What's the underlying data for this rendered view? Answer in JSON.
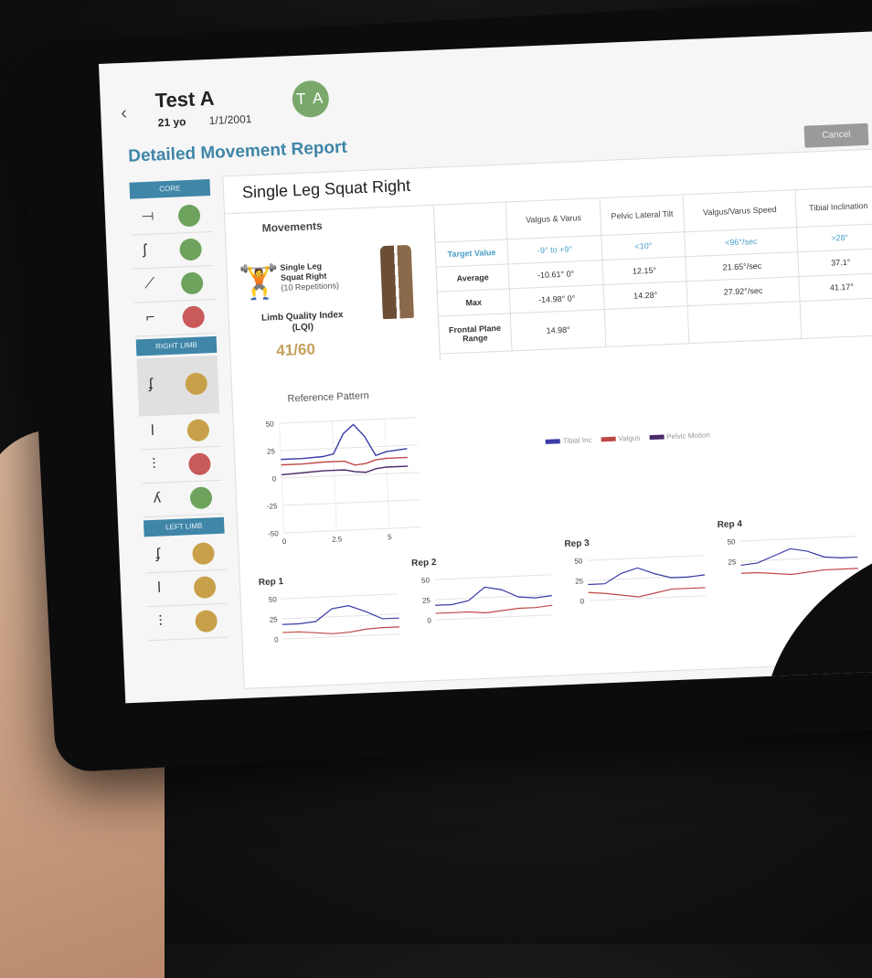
{
  "patient": {
    "name": "Test A",
    "age": "21 yo",
    "dob": "1/1/2001",
    "initials": "T A"
  },
  "report_title": "Detailed Movement Report",
  "cancel_label": "Cancel",
  "sidebar": {
    "core_label": "CORE",
    "right_label": "RIGHT LIMB",
    "left_label": "LEFT LIMB",
    "core": [
      {
        "icon": "plank-icon",
        "status": "green"
      },
      {
        "icon": "squat-icon",
        "status": "green"
      },
      {
        "icon": "side-plank-icon",
        "status": "green"
      },
      {
        "icon": "pushup-icon",
        "status": "red"
      }
    ],
    "right": [
      {
        "icon": "single-leg-squat-icon",
        "status": "yellow",
        "selected": true
      },
      {
        "icon": "single-leg-stand-icon",
        "status": "yellow"
      },
      {
        "icon": "step-icon",
        "status": "red"
      },
      {
        "icon": "lunge-icon",
        "status": "green"
      }
    ],
    "left": [
      {
        "icon": "single-leg-squat-icon",
        "status": "yellow"
      },
      {
        "icon": "single-leg-stand-icon",
        "status": "yellow"
      },
      {
        "icon": "step-icon",
        "status": "yellow"
      }
    ],
    "colors": {
      "green": "#6ea35e",
      "red": "#c85a5a",
      "yellow": "#c9a04a"
    }
  },
  "main": {
    "title": "Single Leg Squat Right",
    "movements_label": "Movements",
    "movement_name": "Single Leg Squat Right",
    "repetitions": "(10 Repetitions)",
    "lqi_label": "Limb Quality Index (LQI)",
    "lqi_value": "41/60"
  },
  "table": {
    "headers": [
      "",
      "Valgus & Varus",
      "Pelvic Lateral Tilt",
      "Valgus/Varus Speed",
      "Tibial Inclination"
    ],
    "rows": [
      {
        "label": "Target Value",
        "cells": [
          "-9° to +9°",
          "<10°",
          "<96°/sec",
          ">28°"
        ]
      },
      {
        "label": "Average",
        "cells": [
          "-10.61°    0°",
          "12.15°",
          "21.65°/sec",
          "37.1°"
        ]
      },
      {
        "label": "Max",
        "cells": [
          "-14.98°    0°",
          "14.28°",
          "27.92°/sec",
          "41.17°"
        ]
      },
      {
        "label": "Frontal Plane Range",
        "cells": [
          "14.98°",
          "",
          "",
          ""
        ]
      }
    ]
  },
  "reference": {
    "title": "Reference Pattern",
    "yticks": [
      "50",
      "25",
      "0",
      "-25",
      "-50"
    ],
    "xticks": [
      "0",
      "2.5",
      "5"
    ]
  },
  "legend": [
    {
      "name": "Tibial Inc",
      "color": "#3a3aa8"
    },
    {
      "name": "Valgus",
      "color": "#c04848"
    },
    {
      "name": "Pelvic Motion",
      "color": "#4a2a6a"
    }
  ],
  "reps": [
    {
      "label": "Rep 1",
      "yticks": [
        "50",
        "25",
        "0"
      ]
    },
    {
      "label": "Rep 2",
      "yticks": [
        "50",
        "25",
        "0"
      ]
    },
    {
      "label": "Rep 3",
      "yticks": [
        "50",
        "25",
        "0"
      ]
    },
    {
      "label": "Rep 4",
      "yticks": [
        "50",
        "25"
      ]
    }
  ],
  "chart_data": {
    "type": "line",
    "title": "Reference Pattern",
    "x": [
      0,
      1,
      2,
      2.5,
      3,
      3.5,
      4,
      4.5,
      5,
      6
    ],
    "ylim": [
      -50,
      50
    ],
    "xlim": [
      0,
      6.5
    ],
    "series": [
      {
        "name": "Tibial Inc",
        "values": [
          17,
          17,
          18,
          20,
          38,
          46,
          35,
          17,
          20,
          22
        ]
      },
      {
        "name": "Valgus",
        "values": [
          12,
          12,
          13,
          13,
          13,
          9,
          10,
          13,
          14,
          14
        ]
      },
      {
        "name": "Pelvic Motion",
        "values": [
          3,
          4,
          5,
          5,
          5,
          3,
          2,
          5,
          6,
          6
        ]
      }
    ]
  }
}
